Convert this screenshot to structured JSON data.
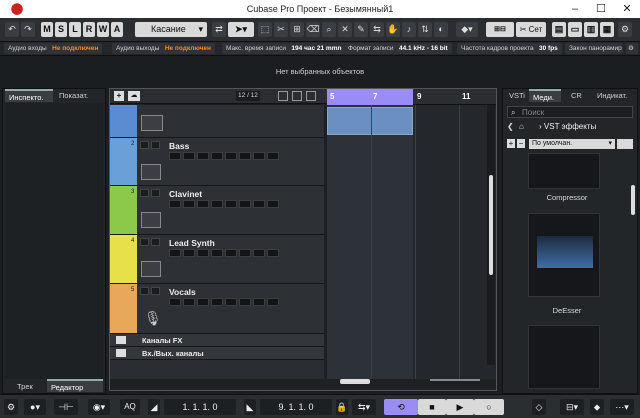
{
  "window": {
    "title": "Cubase Pro Проект - Безымянный1"
  },
  "toolbar": {
    "mode_buttons": [
      "M",
      "S",
      "L",
      "R",
      "W",
      "A"
    ],
    "automation_mode": "Касание",
    "setup_label": "Сет"
  },
  "infoline": {
    "audio_in_label": "Аудио входы",
    "audio_in_value": "Не подключен",
    "audio_out_label": "Аудио выходы",
    "audio_out_value": "Не подключен",
    "max_rec_label": "Макс. время записи",
    "max_rec_value": "194 час 21 mmn",
    "rec_format_label": "Формат записи",
    "rec_format_value": "44.1 kHz - 16 bit",
    "framerate_label": "Частота кадров проекта",
    "framerate_value": "30 fps",
    "panlaw_label": "Закон панорамир"
  },
  "status": {
    "no_selection": "Нет выбранных объектов"
  },
  "left_zone": {
    "tabs": [
      "Инспекто.",
      "Показат."
    ],
    "bottom_tabs": [
      "Трек",
      "Редактор"
    ]
  },
  "project": {
    "track_counter": "12 / 12",
    "ruler_marks": [
      "5",
      "7",
      "9",
      "11"
    ],
    "tracks": [
      {
        "num": "",
        "name": "",
        "color": "#5b8bd0"
      },
      {
        "num": "2",
        "name": "Bass",
        "color": "#6aa0d8"
      },
      {
        "num": "3",
        "name": "Clavinet",
        "color": "#8cc94a"
      },
      {
        "num": "4",
        "name": "Lead Synth",
        "color": "#e8e04a"
      },
      {
        "num": "5",
        "name": "Vocals",
        "color": "#e8a85a"
      }
    ],
    "folder_tracks": [
      "Каналы FX",
      "Вх./Вых. каналы"
    ]
  },
  "right_zone": {
    "tabs": [
      "VSTi",
      "Меди.",
      "CR",
      "Индикат."
    ],
    "search_placeholder": "Поиск",
    "breadcrumb": "VST эффекты",
    "sort_value": "По умолчан.",
    "plugins": [
      "Compressor",
      "DeEsser"
    ]
  },
  "transport": {
    "left_locator": "1. 1. 1. 0",
    "right_locator": "9. 1. 1. 0",
    "aq_label": "AQ"
  },
  "colors": {
    "accent": "#9a8cf5",
    "warning": "#f08a24",
    "event": "#6a8fc0"
  }
}
